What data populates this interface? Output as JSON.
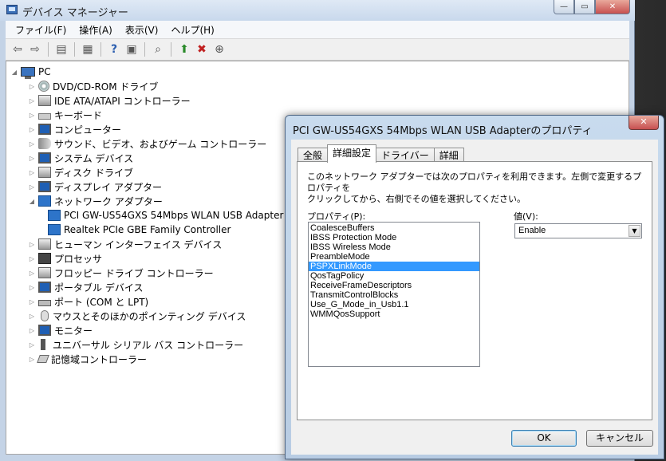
{
  "window": {
    "title": "デバイス マネージャー",
    "controls": {
      "minimize": "—",
      "maximize": "▭",
      "close": "✕"
    }
  },
  "menu": [
    "ファイル(F)",
    "操作(A)",
    "表示(V)",
    "ヘルプ(H)"
  ],
  "toolbar": {
    "icons": [
      "back-arrow-icon",
      "forward-arrow-icon",
      "show-hide-tree-icon",
      "properties-icon",
      "help-icon",
      "view-icon",
      "scan-hardware-icon",
      "update-driver-icon",
      "disable-device-icon",
      "uninstall-device-icon"
    ]
  },
  "tree": {
    "root": "PC",
    "items": [
      {
        "label": "DVD/CD-ROM ドライブ",
        "icon": "disc-drive-icon"
      },
      {
        "label": "IDE ATA/ATAPI コントローラー",
        "icon": "ide-controller-icon"
      },
      {
        "label": "キーボード",
        "icon": "keyboard-icon"
      },
      {
        "label": "コンピューター",
        "icon": "computer-icon"
      },
      {
        "label": "サウンド、ビデオ、およびゲーム コントローラー",
        "icon": "sound-icon"
      },
      {
        "label": "システム デバイス",
        "icon": "system-device-icon"
      },
      {
        "label": "ディスク ドライブ",
        "icon": "disk-drive-icon"
      },
      {
        "label": "ディスプレイ アダプター",
        "icon": "display-adapter-icon"
      },
      {
        "label": "ネットワーク アダプター",
        "icon": "network-adapter-icon",
        "expanded": true,
        "children": [
          {
            "label": "PCI GW-US54GXS 54Mbps WLAN USB Adapter",
            "icon": "network-card-icon"
          },
          {
            "label": "Realtek PCIe GBE Family Controller",
            "icon": "network-card-icon"
          }
        ]
      },
      {
        "label": "ヒューマン インターフェイス デバイス",
        "icon": "hid-icon"
      },
      {
        "label": "プロセッサ",
        "icon": "processor-icon"
      },
      {
        "label": "フロッピー ドライブ コントローラー",
        "icon": "floppy-controller-icon"
      },
      {
        "label": "ポータブル デバイス",
        "icon": "portable-device-icon"
      },
      {
        "label": "ポート (COM と LPT)",
        "icon": "port-icon"
      },
      {
        "label": "マウスとそのほかのポインティング デバイス",
        "icon": "mouse-icon"
      },
      {
        "label": "モニター",
        "icon": "monitor-icon"
      },
      {
        "label": "ユニバーサル シリアル バス コントローラー",
        "icon": "usb-icon"
      },
      {
        "label": "記憶域コントローラー",
        "icon": "storage-controller-icon"
      }
    ]
  },
  "dialog": {
    "title": "PCI GW-US54GXS 54Mbps WLAN USB Adapterのプロパティ",
    "close": "✕",
    "tabs": [
      {
        "label": "全般",
        "active": false
      },
      {
        "label": "詳細設定",
        "active": true
      },
      {
        "label": "ドライバー",
        "active": false
      },
      {
        "label": "詳細",
        "active": false
      }
    ],
    "description_line1": "このネットワーク アダプターでは次のプロパティを利用できます。左側で変更するプロパティを",
    "description_line2": "クリックしてから、右側でその値を選択してください。",
    "property_label": "プロパティ(P):",
    "value_label": "値(V):",
    "properties": [
      "CoalesceBuffers",
      "IBSS Protection Mode",
      "IBSS Wireless Mode",
      "PreambleMode",
      "PSPXLinkMode",
      "QosTagPolicy",
      "ReceiveFrameDescriptors",
      "TransmitControlBlocks",
      "Use_G_Mode_in_Usb1.1",
      "WMMQosSupport"
    ],
    "selected_property": "PSPXLinkMode",
    "value": "Enable",
    "ok_label": "OK",
    "cancel_label": "キャンセル",
    "selection_color": "#3399ff"
  }
}
